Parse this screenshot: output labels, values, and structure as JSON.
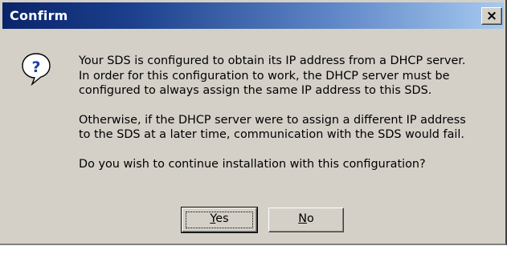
{
  "dialog": {
    "title": "Confirm",
    "close_glyph": "×",
    "icon": "question-icon",
    "message": {
      "paragraph1": [
        "Your SDS is configured to obtain its IP address from a DHCP server.",
        "In order for this configuration to work, the DHCP server must be",
        "configured to always assign the same IP address to this SDS."
      ],
      "paragraph2": [
        "Otherwise, if the DHCP server were to assign a different IP address",
        "to the SDS at a later time, communication with the SDS would fail."
      ],
      "paragraph3": "Do you wish to continue installation with this configuration?"
    },
    "buttons": {
      "yes": {
        "mnemonic": "Y",
        "rest": "es"
      },
      "no": {
        "mnemonic": "N",
        "rest": "o"
      }
    }
  },
  "colors": {
    "titlebar_start": "#0a246a",
    "titlebar_end": "#a6caf0",
    "dialog_face": "#d4d0c8",
    "icon_blue": "#1f3fa0"
  }
}
